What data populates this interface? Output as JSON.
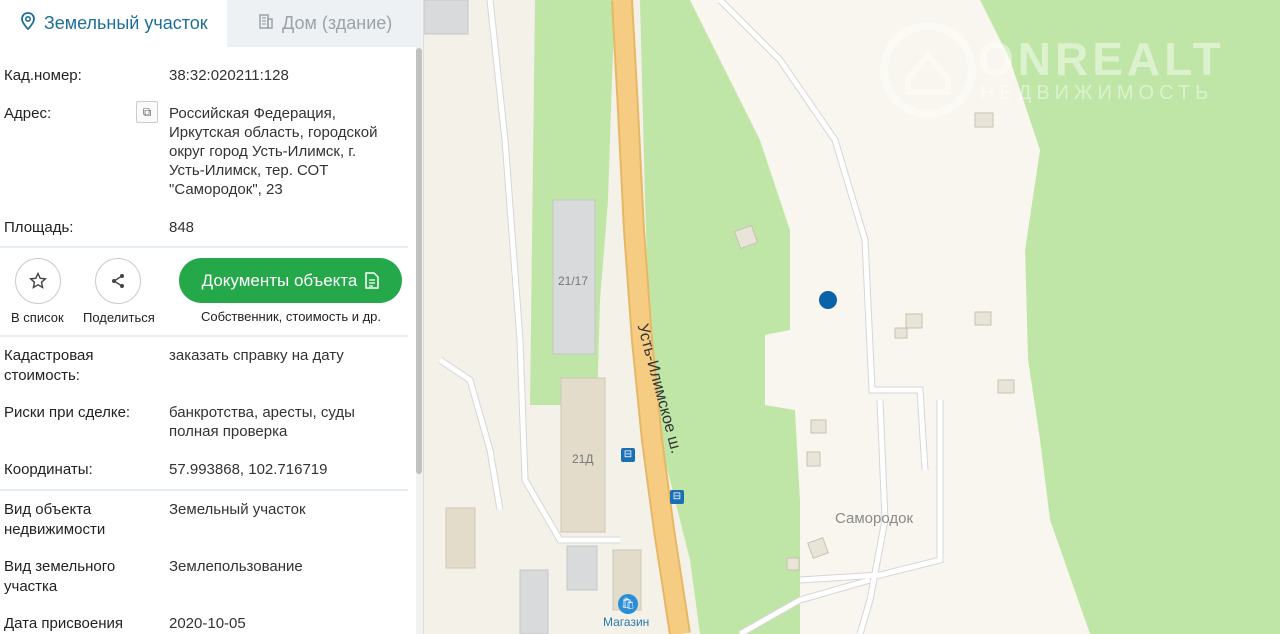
{
  "map": {
    "road_label": "Усть-Илимское ш.",
    "area_label": "Самородок",
    "building_labels": [
      "21/17",
      "21Д"
    ],
    "shop_label": "Магазин",
    "watermark_title": "ONREALT",
    "watermark_sub": "НЕДВИЖИМОСТЬ",
    "colors": {
      "background": "#f4f1e8",
      "forest": "#bfe6a6",
      "road": "#f3c27a",
      "marker": "#0a63a8"
    }
  },
  "tabs": {
    "land": {
      "label": "Земельный участок",
      "icon": "location-pin-icon"
    },
    "building": {
      "label": "Дом (здание)",
      "icon": "building-icon"
    }
  },
  "fields": {
    "cad_number": {
      "label": "Кад.номер:",
      "value": "38:32:020211:128"
    },
    "address": {
      "label": "Адрес:",
      "value": "Российская Федерация, Иркутская область, городской округ город Усть-Илимск, г. Усть-Илимск, тер. СОТ \"Самородок\", 23"
    },
    "area": {
      "label": "Площадь:",
      "value": "848"
    },
    "cad_cost": {
      "label": "Кадастровая стоимость:",
      "link": "заказать справку на дату"
    },
    "risks": {
      "label": "Риски при сделке:",
      "value": "банкротства, аресты, суды",
      "link": "полная проверка"
    },
    "coords": {
      "label": "Координаты:",
      "value": "57.993868, 102.716719"
    },
    "object_type": {
      "label": "Вид объекта недвижимости",
      "value": "Земельный участок"
    },
    "land_type": {
      "label": "Вид земельного участка",
      "value": "Землепользование"
    },
    "assign_date": {
      "label": "Дата присвоения",
      "value": "2020-10-05"
    }
  },
  "actions": {
    "add_list": {
      "label": "В список",
      "icon": "star-icon"
    },
    "share": {
      "label": "Поделиться",
      "icon": "share-icon"
    },
    "docs": {
      "label": "Документы объекта",
      "sub": "Собственник, стоимость и др.",
      "icon": "document-icon"
    }
  }
}
